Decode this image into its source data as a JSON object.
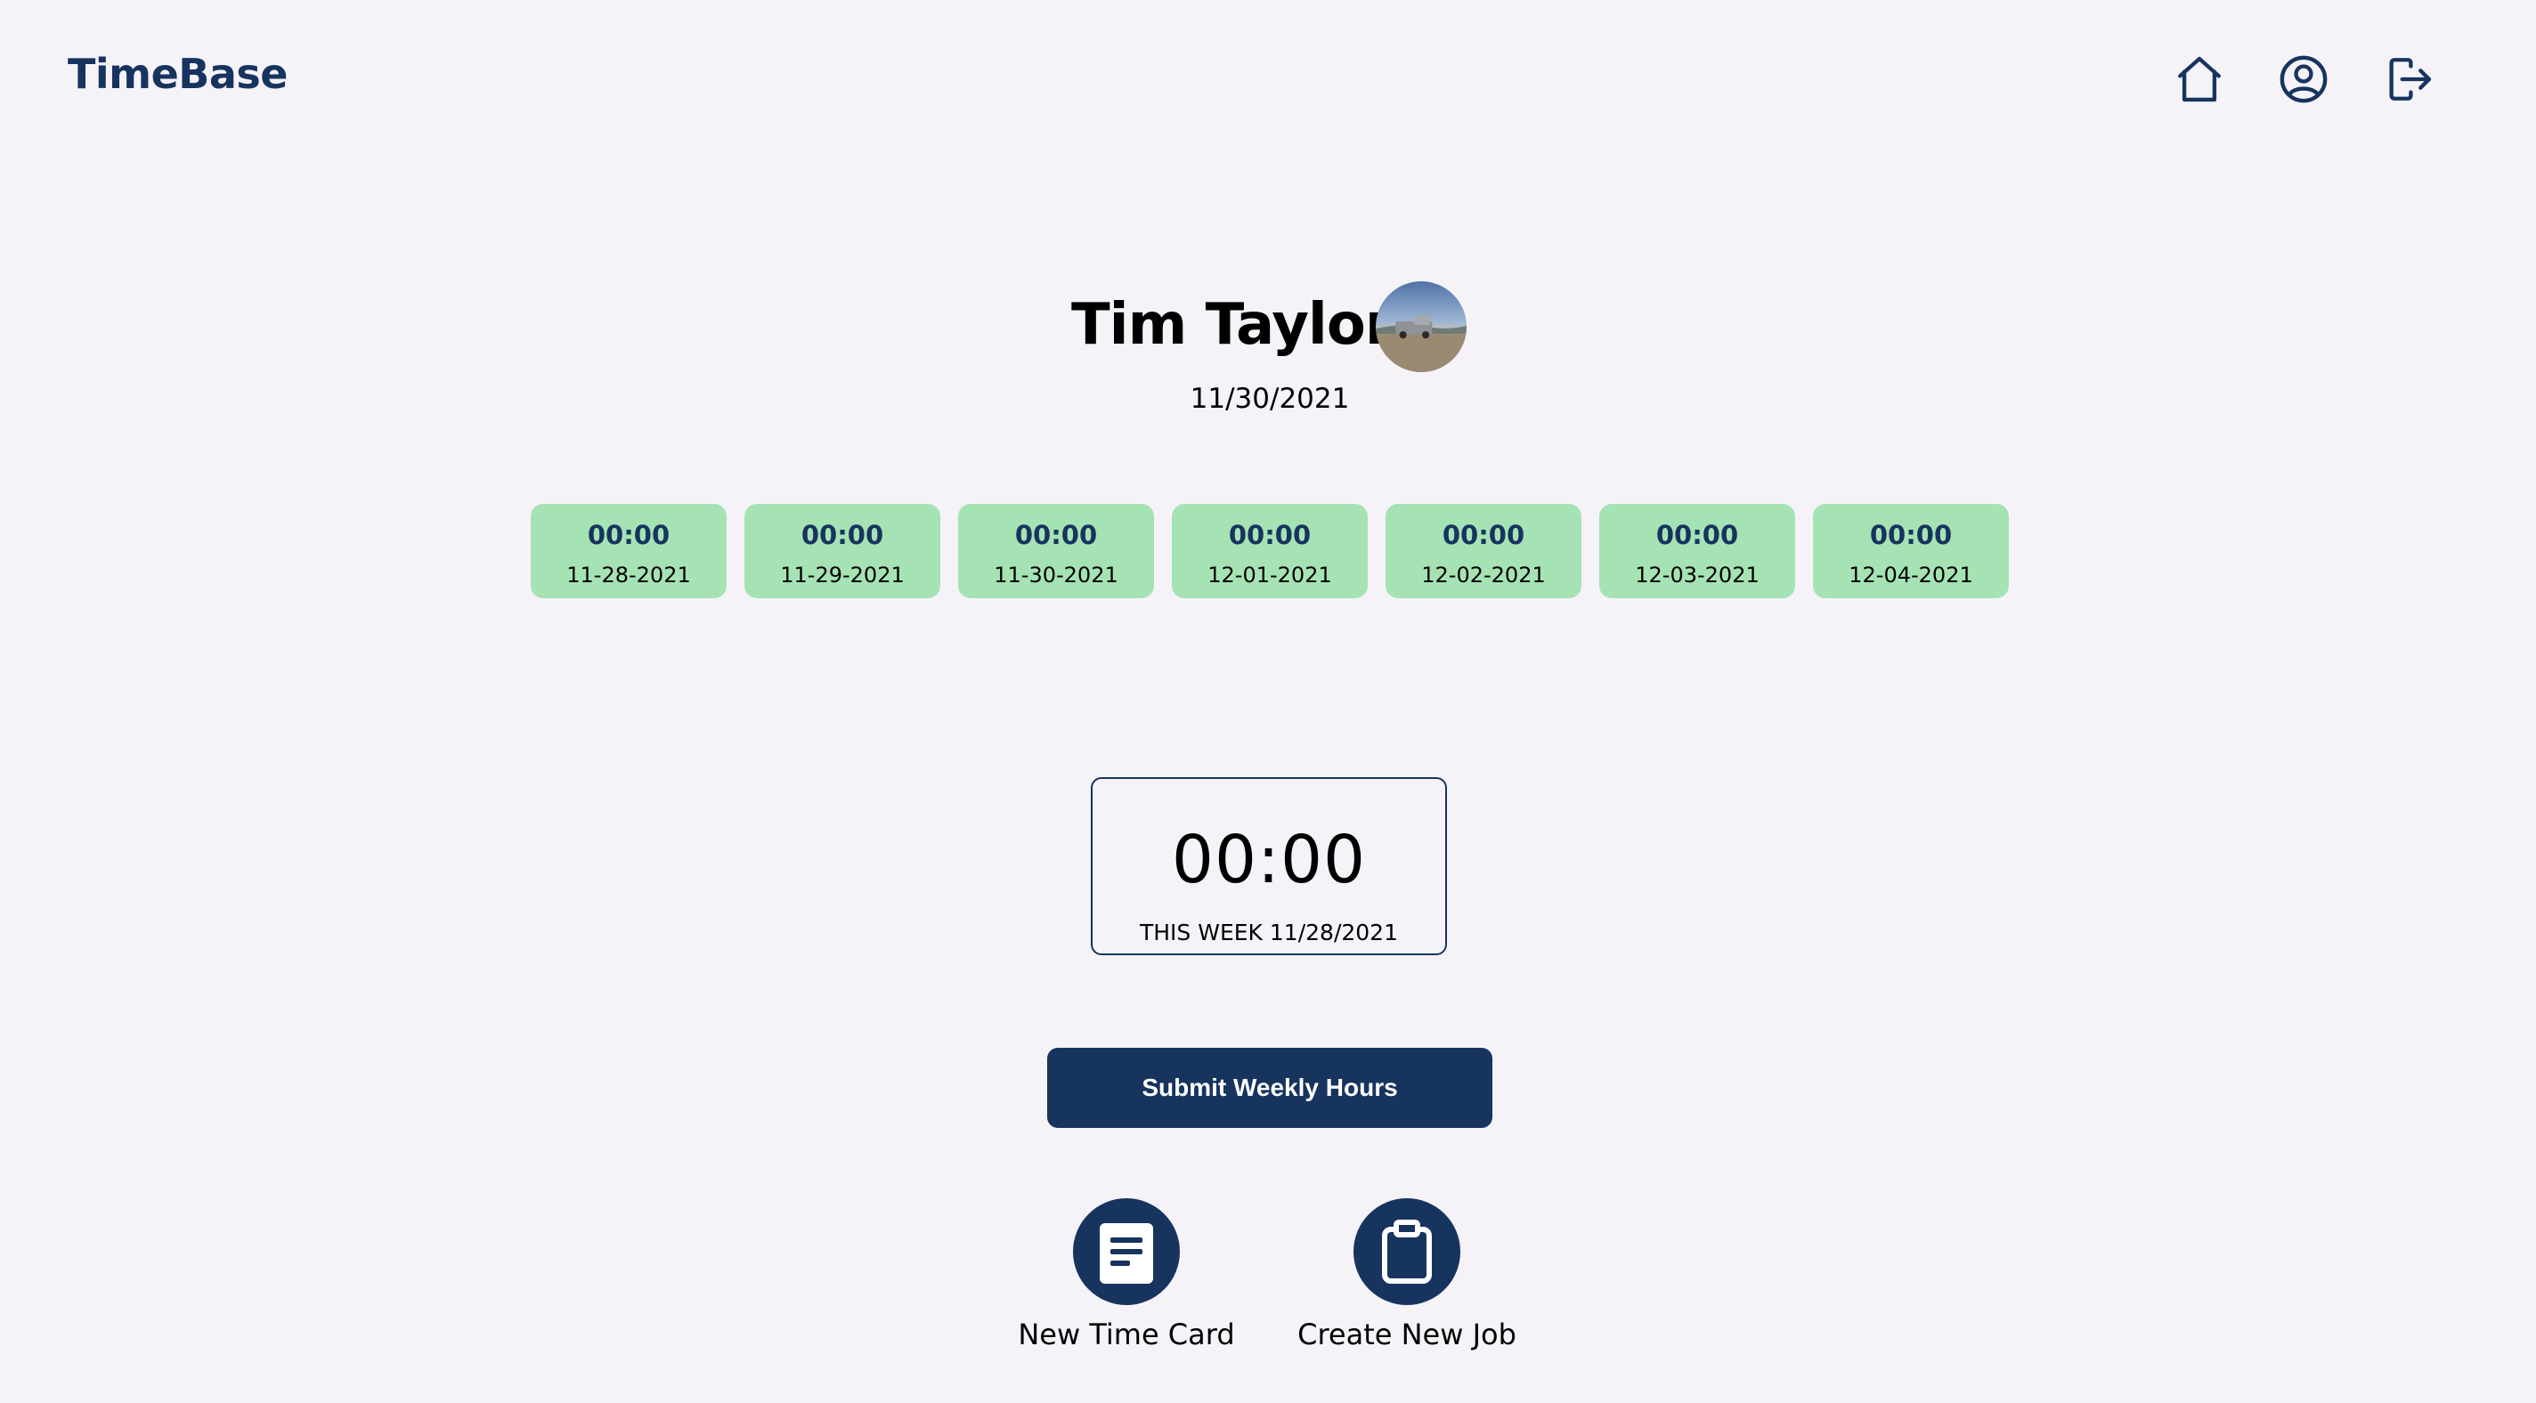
{
  "app": {
    "brand": "TimeBase"
  },
  "nav": {
    "items": [
      {
        "name": "home",
        "icon": "home-icon"
      },
      {
        "name": "profile",
        "icon": "user-circle-icon"
      },
      {
        "name": "logout",
        "icon": "logout-icon"
      }
    ]
  },
  "user": {
    "name": "Tim Taylor",
    "avatar": "pickup-truck-photo",
    "today": "11/30/2021"
  },
  "days": [
    {
      "hours": "00:00",
      "date": "11-28-2021"
    },
    {
      "hours": "00:00",
      "date": "11-29-2021"
    },
    {
      "hours": "00:00",
      "date": "11-30-2021"
    },
    {
      "hours": "00:00",
      "date": "12-01-2021"
    },
    {
      "hours": "00:00",
      "date": "12-02-2021"
    },
    {
      "hours": "00:00",
      "date": "12-03-2021"
    },
    {
      "hours": "00:00",
      "date": "12-04-2021"
    }
  ],
  "week": {
    "total": "00:00",
    "label": "THIS WEEK 11/28/2021"
  },
  "submit": {
    "label": "Submit Weekly Hours"
  },
  "actions": {
    "new_time_card": {
      "label": "New Time Card",
      "icon": "document-icon"
    },
    "create_job": {
      "label": "Create New Job",
      "icon": "clipboard-icon"
    }
  },
  "colors": {
    "primary": "#17345f",
    "day_card": "#a6e3b4",
    "background": "#f5f3f8"
  }
}
